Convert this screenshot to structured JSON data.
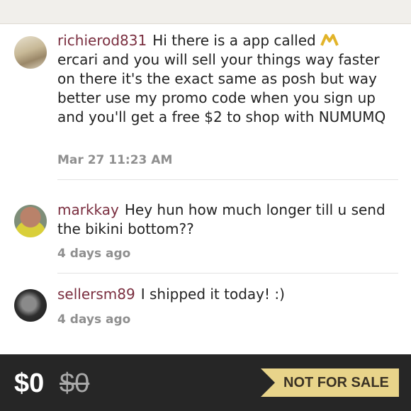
{
  "comments": [
    {
      "username": "richierod831",
      "text_before_logo": "Hi there is a app called",
      "text_after_logo": "ercari and you will sell your things way faster on there it's the exact same as posh but way better use my promo code when you sign up and you'll get a free $2 to shop with NUMUMQ",
      "timestamp": "Mar 27 11:23 AM"
    },
    {
      "username": "markkay",
      "text": "Hey hun how much longer till u send the bikini bottom??",
      "timestamp": "4 days ago"
    },
    {
      "username": "sellersm89",
      "text": "I shipped it today! :)",
      "timestamp": "4 days ago"
    }
  ],
  "listing": {
    "price": "$0",
    "original_price": "$0",
    "status_label": "NOT FOR SALE"
  },
  "colors": {
    "username": "#7a2e3f",
    "bottom_bar": "#262626",
    "badge": "#e8d48a"
  }
}
